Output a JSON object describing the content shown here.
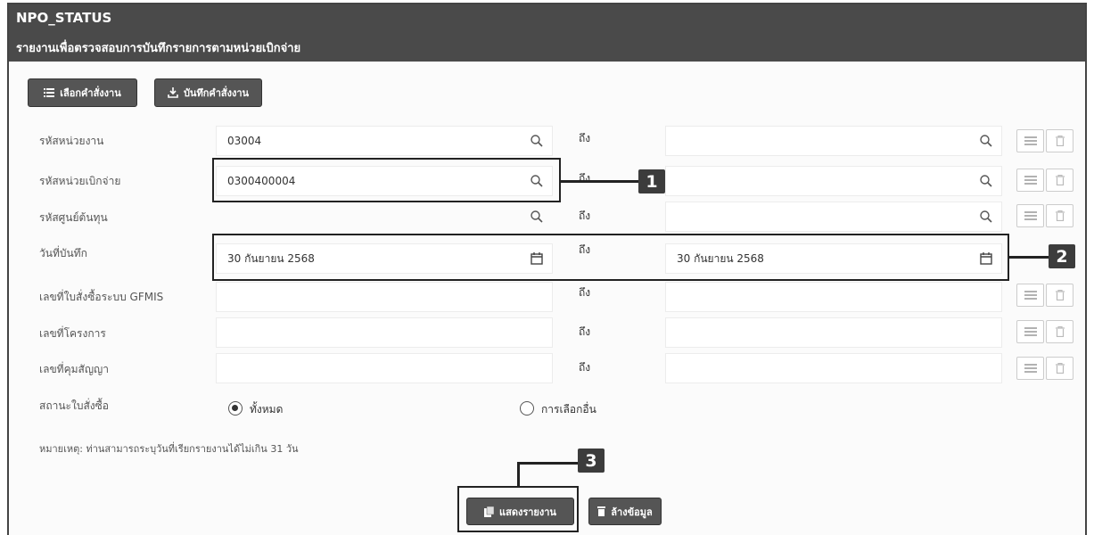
{
  "header": {
    "code": "NPO_STATUS",
    "subtitle": "รายงานเพื่อตรวจสอบการบันทึกรายการตามหน่วยเบิกจ่าย"
  },
  "toolbar": {
    "select_label": "เลือกคำสั่งงาน",
    "save_label": "บันทึกคำสั่งงาน"
  },
  "range_word": "ถึง",
  "fields": {
    "agency_code": {
      "label": "รหัสหน่วยงาน",
      "from": "03004",
      "to": ""
    },
    "disbursing_unit": {
      "label": "รหัสหน่วยเบิกจ่าย",
      "from": "0300400004",
      "to": ""
    },
    "cost_center": {
      "label": "รหัสศูนย์ต้นทุน",
      "from": "",
      "to": ""
    },
    "record_date": {
      "label": "วันที่บันทึก",
      "from": "30 กันยายน 2568",
      "to": "30 กันยายน 2568"
    },
    "po_number": {
      "label": "เลขที่ใบสั่งซื้อระบบ GFMIS",
      "from": "",
      "to": ""
    },
    "project_number": {
      "label": "เลขที่โครงการ",
      "from": "",
      "to": ""
    },
    "contract_number": {
      "label": "เลขที่คุมสัญญา",
      "from": "",
      "to": ""
    }
  },
  "po_status": {
    "label": "สถานะใบสั่งซื้อ",
    "options": [
      "ทั้งหมด",
      "การเลือกอื่น"
    ],
    "selected": "ทั้งหมด"
  },
  "note": "หมายเหตุ: ท่านสามารถระบุวันที่เรียกรายงานได้ไม่เกิน 31 วัน",
  "actions": {
    "show_report": "แสดงรายงาน",
    "clear": "ล้างข้อมูล"
  },
  "callouts": [
    "1",
    "2",
    "3"
  ]
}
